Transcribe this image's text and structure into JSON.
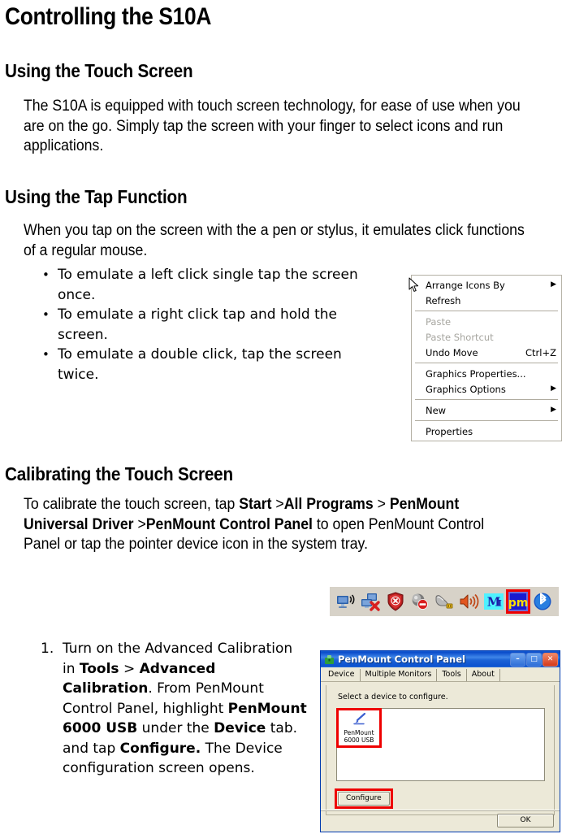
{
  "page": {
    "title": "Controlling the S10A"
  },
  "sections": {
    "touch_screen": {
      "heading": "Using the Touch Screen",
      "paragraph": "The S10A is equipped with touch screen technology, for ease of use when you are on the go. Simply tap the screen with your finger to select icons and run applications."
    },
    "tap_function": {
      "heading": "Using the Tap Function",
      "paragraph": "When you tap on the screen with the a pen or stylus, it emulates click functions of a regular mouse.",
      "bullet_marker": "•",
      "bullets": [
        "To emulate a left click single tap the screen once.",
        "To emulate a right click tap and hold the screen.",
        "To emulate a double click, tap the screen twice."
      ]
    },
    "calibrating": {
      "heading": "Calibrating the Touch Screen",
      "paragraph_parts": [
        {
          "text": "To calibrate the touch screen, tap ",
          "bold": false
        },
        {
          "text": "Start",
          "bold": true
        },
        {
          "text": " >",
          "bold": false
        },
        {
          "text": "All Programs",
          "bold": true
        },
        {
          "text": " > ",
          "bold": false
        },
        {
          "text": "PenMount Universal Driver",
          "bold": true
        },
        {
          "text": " >",
          "bold": false
        },
        {
          "text": "PenMount Control Panel",
          "bold": true
        },
        {
          "text": " to open PenMount Control Panel or tap the pointer device icon in the system tray.",
          "bold": false
        }
      ],
      "steps": [
        {
          "marker": "1.",
          "parts": [
            {
              "text": "Turn on the Advanced Calibration in ",
              "bold": false
            },
            {
              "text": "Tools",
              "bold": true
            },
            {
              "text": " > ",
              "bold": false
            },
            {
              "text": "Advanced Calibration",
              "bold": true
            },
            {
              "text": ". From PenMount Control Panel, highlight ",
              "bold": false
            },
            {
              "text": "PenMount 6000 USB",
              "bold": true
            },
            {
              "text": " under the ",
              "bold": false
            },
            {
              "text": "Device",
              "bold": true
            },
            {
              "text": " tab. and tap ",
              "bold": false
            },
            {
              "text": "Configure.",
              "bold": true
            },
            {
              "text": " The Device configuration screen opens.",
              "bold": false
            }
          ]
        }
      ]
    }
  },
  "context_menu": {
    "groups": [
      [
        {
          "label": "Arrange Icons By",
          "accel": "",
          "submenu": true,
          "disabled": false
        },
        {
          "label": "Refresh",
          "accel": "",
          "submenu": false,
          "disabled": false
        }
      ],
      [
        {
          "label": "Paste",
          "accel": "",
          "submenu": false,
          "disabled": true
        },
        {
          "label": "Paste Shortcut",
          "accel": "",
          "submenu": false,
          "disabled": true
        },
        {
          "label": "Undo Move",
          "accel": "Ctrl+Z",
          "submenu": false,
          "disabled": false
        }
      ],
      [
        {
          "label": "Graphics Properties...",
          "accel": "",
          "submenu": false,
          "disabled": false
        },
        {
          "label": "Graphics Options",
          "accel": "",
          "submenu": true,
          "disabled": false
        }
      ],
      [
        {
          "label": "New",
          "accel": "",
          "submenu": true,
          "disabled": false
        }
      ],
      [
        {
          "label": "Properties",
          "accel": "",
          "submenu": false,
          "disabled": false
        }
      ]
    ],
    "submenu_glyph": "▶",
    "background_color": "#ffffff",
    "border_color": "#b4b0a4"
  },
  "system_tray": {
    "background_color": "#d7d2c8",
    "highlight_color": "#ee0000",
    "icons": [
      {
        "name": "wireless-network-icon",
        "highlighted": false
      },
      {
        "name": "network-disconnected-icon",
        "highlighted": false
      },
      {
        "name": "security-shield-alert-icon",
        "highlighted": false
      },
      {
        "name": "antivirus-disabled-icon",
        "highlighted": false
      },
      {
        "name": "usb-mouse-icon",
        "highlighted": false
      },
      {
        "name": "volume-speaker-icon",
        "highlighted": false
      },
      {
        "name": "m-letter-icon",
        "highlighted": false
      },
      {
        "name": "penmount-pm-icon",
        "highlighted": true
      },
      {
        "name": "bluetooth-icon",
        "highlighted": false
      }
    ]
  },
  "penmount_dialog": {
    "title": "PenMount Control Panel",
    "window_buttons": {
      "minimize": "–",
      "maximize": "□",
      "close": "✕"
    },
    "tabs": [
      {
        "label": "Device",
        "active": true
      },
      {
        "label": "Multiple Monitors",
        "active": false
      },
      {
        "label": "Tools",
        "active": false
      },
      {
        "label": "About",
        "active": false
      }
    ],
    "instruction": "Select a device to configure.",
    "device": {
      "name_line1": "PenMount",
      "name_line2": "6000 USB",
      "highlighted": true
    },
    "configure_button": {
      "label": "Configure",
      "highlighted": true
    },
    "ok_button": {
      "label": "OK"
    },
    "highlight_color": "#ee0000",
    "titlebar_color": "#0a4ccb",
    "face_color": "#ece9d8"
  }
}
